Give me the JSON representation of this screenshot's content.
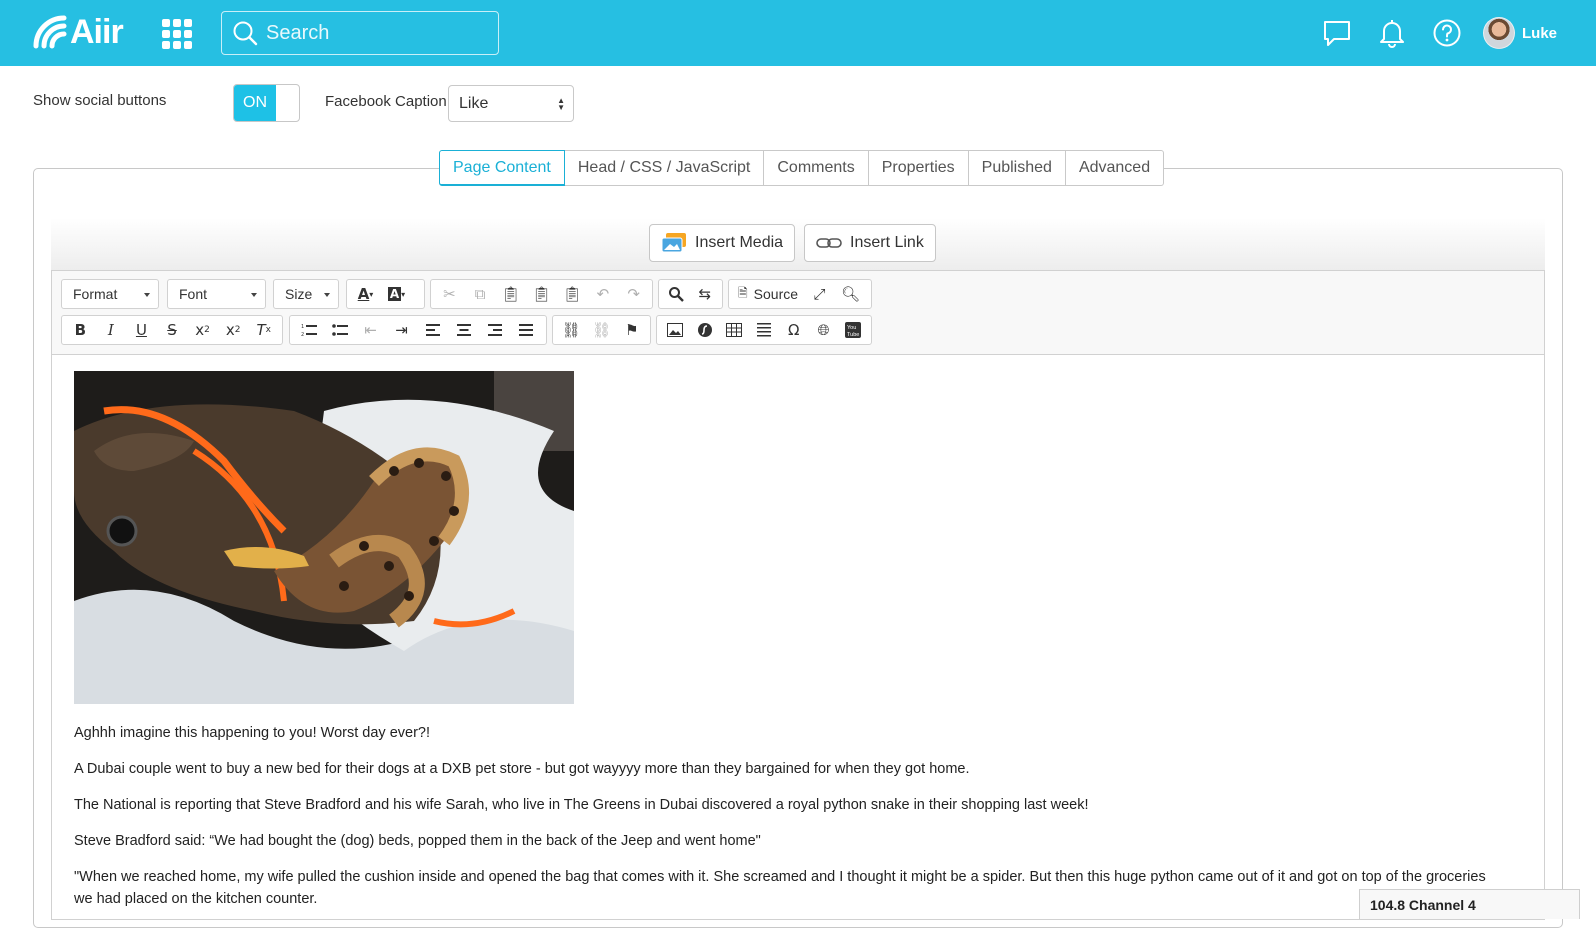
{
  "brand": {
    "name": "Aiir"
  },
  "search": {
    "placeholder": "Search"
  },
  "header_icons": [
    "chat-bubble-icon",
    "bell-icon",
    "help-icon"
  ],
  "user": {
    "name": "Luke"
  },
  "settings": {
    "social_label": "Show social buttons",
    "social_toggle": "ON",
    "facebook_label": "Facebook Caption",
    "facebook_value": "Like"
  },
  "tabs": [
    {
      "label": "Page Content",
      "active": true
    },
    {
      "label": "Head / CSS / JavaScript",
      "active": false
    },
    {
      "label": "Comments",
      "active": false
    },
    {
      "label": "Properties",
      "active": false
    },
    {
      "label": "Published",
      "active": false
    },
    {
      "label": "Advanced",
      "active": false
    }
  ],
  "media": {
    "insert_media": "Insert Media",
    "insert_link": "Insert Link"
  },
  "toolbar": {
    "format": "Format",
    "font": "Font",
    "size": "Size",
    "source": "Source"
  },
  "content": {
    "image_alt": "python snake in dog bed bag",
    "paragraphs": [
      "Aghhh imagine this happening to you! Worst day ever?!",
      "A Dubai couple went to buy a new bed for their dogs at a DXB pet store - but got wayyyy more than they bargained for when they got home.",
      "The National is reporting that Steve Bradford and his wife Sarah, who live in The Greens in Dubai discovered a royal python snake in their shopping last week!",
      "Steve Bradford said: “We had bought the (dog) beds, popped them in the back of the Jeep and went home\"",
      "\"When we reached home, my wife pulled the cushion inside and opened the bag that comes with it. She screamed and I thought it might be a spider. But then this huge python came out of it and got on top of the groceries we had placed on the kitchen counter."
    ]
  },
  "player": {
    "station": "104.8 Channel 4"
  },
  "colors": {
    "brand": "#26bfe2",
    "accent": "#1ab0d6",
    "toggle_on": "#1ec1e6"
  }
}
